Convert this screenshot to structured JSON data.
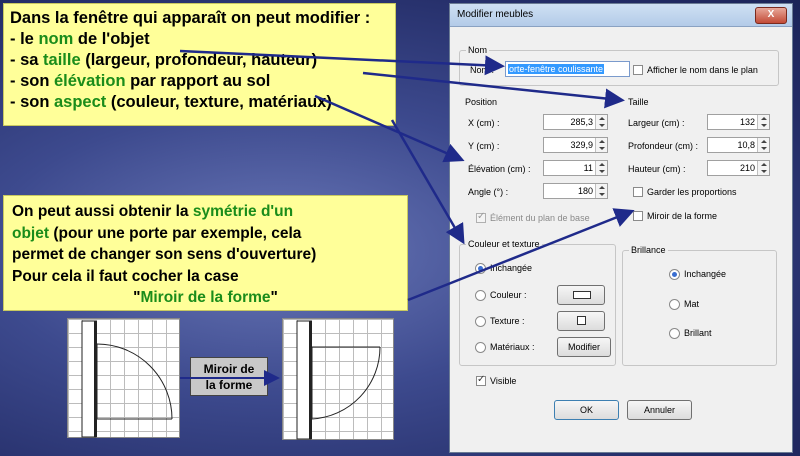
{
  "notes": {
    "note1": {
      "l1": "Dans la fenêtre qui apparaît on peut modifier :",
      "l2a": "- le ",
      "l2b": "nom",
      "l2c": " de l'objet",
      "l3a": "- sa ",
      "l3b": "taille",
      "l3c": " (largeur, profondeur, hauteur)",
      "l4a": "- son ",
      "l4b": "élévation",
      "l4c": " par rapport au sol",
      "l5a": "- son ",
      "l5b": "aspect",
      "l5c": " (couleur, texture, matériaux)"
    },
    "note2": {
      "l1a": "On peut aussi obtenir la ",
      "l1b": "symétrie d'un",
      "l2a": "objet",
      "l2b": " (pour une porte par exemple, cela",
      "l3": "permet de changer son sens d'ouverture)",
      "l4": "Pour cela il faut cocher la case",
      "l5a": "\"",
      "l5b": "Miroir de la forme",
      "l5c": "\""
    }
  },
  "mirror_label": {
    "l1": "Miroir de",
    "l2": "la forme"
  },
  "dialog": {
    "title": "Modifier meubles",
    "close": "X",
    "name_group": "Nom",
    "name_label": "Nom :",
    "name_value": "orte-fenêtre coulissante",
    "show_name": "Afficher le nom dans le plan",
    "position_group": "Position",
    "x_label": "X (cm) :",
    "x_value": "285,3",
    "y_label": "Y (cm) :",
    "y_value": "329,9",
    "elev_label": "Élévation (cm) :",
    "elev_value": "11",
    "angle_label": "Angle (°) :",
    "angle_value": "180",
    "base_plan": "Élément du plan de base",
    "size_group": "Taille",
    "width_label": "Largeur (cm) :",
    "width_value": "132",
    "depth_label": "Profondeur (cm) :",
    "depth_value": "10,8",
    "height_label": "Hauteur (cm) :",
    "height_value": "210",
    "keep_prop": "Garder les proportions",
    "mirror": "Miroir de la forme",
    "color_group": "Couleur et texture",
    "unchanged": "Inchangée",
    "color": "Couleur :",
    "texture": "Texture :",
    "materials": "Matériaux :",
    "modify": "Modifier",
    "shine_group": "Brillance",
    "shine_unchanged": "Inchangée",
    "matte": "Mat",
    "shiny": "Brillant",
    "visible": "Visible",
    "ok": "OK",
    "cancel": "Annuler"
  },
  "colors": {
    "note_bg": "#ffff99",
    "green": "#1a8c1a",
    "arrow": "#1f2a8a"
  }
}
